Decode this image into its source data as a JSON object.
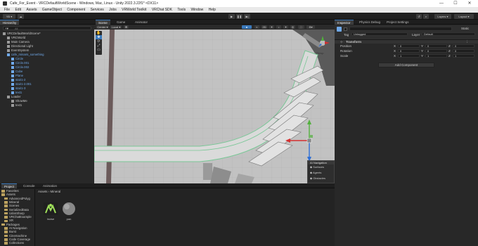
{
  "window": {
    "title": "Cafe_For_Event - VRCDefaultWorldScene - Windows, Mac, Linux - Unity 2022.3.22f1* <DX11>",
    "controls": [
      "—",
      "☐",
      "✕"
    ]
  },
  "menu": [
    "File",
    "Edit",
    "Assets",
    "GameObject",
    "Component",
    "Services",
    "Jobs",
    "VRWorld Toolkit",
    "VRChat SDK",
    "Tools",
    "Window",
    "Help"
  ],
  "toolbar": {
    "account": "YB",
    "layers": "Layers",
    "layout": "Layout"
  },
  "hierarchy": {
    "tab": "Hierarchy",
    "search_placeholder": "All",
    "items": [
      {
        "label": "VRCDefaultWorldScene*",
        "depth": 0,
        "blue": false
      },
      {
        "label": "VRCWorld",
        "depth": 1,
        "blue": false
      },
      {
        "label": "Main Camera",
        "depth": 1,
        "blue": false
      },
      {
        "label": "Directional Light",
        "depth": 1,
        "blue": false
      },
      {
        "label": "EventSystem",
        "depth": 1,
        "blue": false
      },
      {
        "label": "cafe_minami_something",
        "depth": 1,
        "blue": true
      },
      {
        "label": "Circle",
        "depth": 2,
        "blue": true
      },
      {
        "label": "Circle.001",
        "depth": 2,
        "blue": true
      },
      {
        "label": "Circle.002",
        "depth": 2,
        "blue": true
      },
      {
        "label": "Cube",
        "depth": 2,
        "blue": true
      },
      {
        "label": "Plane",
        "depth": 2,
        "blue": true
      },
      {
        "label": "stair1-2",
        "depth": 2,
        "blue": true
      },
      {
        "label": "stair1-2.001",
        "depth": 2,
        "blue": true
      },
      {
        "label": "stair1-3",
        "depth": 2,
        "blue": true
      },
      {
        "label": "text1",
        "depth": 2,
        "blue": true
      },
      {
        "label": "Loader",
        "depth": 1,
        "blue": false
      },
      {
        "label": "ShowMe",
        "depth": 2,
        "blue": false
      },
      {
        "label": "text1",
        "depth": 2,
        "blue": false
      }
    ]
  },
  "scene": {
    "tabs": [
      "Scene",
      "Game",
      "Animator"
    ],
    "toolbar": {
      "center": "Center",
      "local": "Local",
      "mode": "Persp"
    },
    "nav_overlay": {
      "title": "AI Navigation",
      "items": [
        "Surfaces",
        "Agents",
        "Obstacles"
      ]
    }
  },
  "inspector": {
    "tabs": [
      "Inspector",
      "Physics Debug",
      "Project Settings"
    ],
    "static_label": "Static",
    "tag_label": "Tag",
    "tag_value": "Untagged",
    "layer_label": "Layer",
    "layer_value": "Default",
    "component": "Transform",
    "rows": [
      {
        "label": "Position",
        "x": "0",
        "y": "0",
        "z": "0"
      },
      {
        "label": "Rotation",
        "x": "0",
        "y": "0",
        "z": "0"
      },
      {
        "label": "Scale",
        "x": "1",
        "y": "1",
        "z": "1"
      }
    ],
    "add_component": "Add Component"
  },
  "project": {
    "tabs": [
      "Project",
      "Console",
      "Animation"
    ],
    "breadcrumb": [
      "Assets",
      "Mineral"
    ],
    "tree": [
      {
        "label": "Favorites",
        "depth": 0
      },
      {
        "label": "Assets",
        "depth": 0
      },
      {
        "label": "AdvancedPolyg",
        "depth": 1
      },
      {
        "label": "Mineral",
        "depth": 1
      },
      {
        "label": "Scenes",
        "depth": 1
      },
      {
        "label": "SerializedData",
        "depth": 1
      },
      {
        "label": "UdonSharp",
        "depth": 1
      },
      {
        "label": "VRChatExample",
        "depth": 1
      },
      {
        "label": "XR",
        "depth": 1
      },
      {
        "label": "Packages",
        "depth": 0
      },
      {
        "label": "AI Navigation",
        "depth": 1
      },
      {
        "label": "Burst",
        "depth": 1
      },
      {
        "label": "Cinemachine",
        "depth": 1
      },
      {
        "label": "Code Coverage",
        "depth": 1
      },
      {
        "label": "Collections",
        "depth": 1
      }
    ],
    "assets": [
      {
        "label": "Incise"
      },
      {
        "label": "pan"
      }
    ]
  },
  "colors": {
    "accent": "#3a79bb",
    "axis_x": "#d43030",
    "axis_y": "#52b13d",
    "axis_z": "#2e6fd6"
  }
}
